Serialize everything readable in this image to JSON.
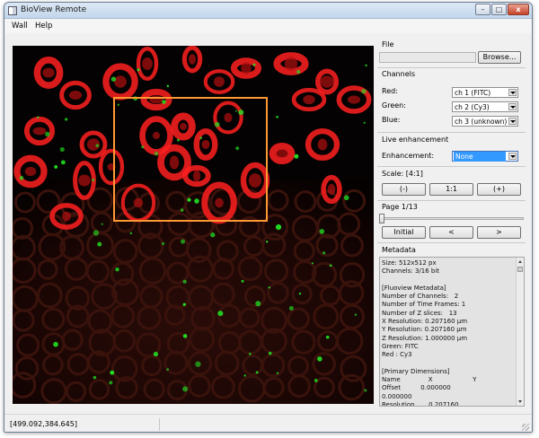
{
  "window": {
    "title": "BioView Remote",
    "minimize": "–",
    "maximize": "□",
    "close": "x"
  },
  "menu": [
    "Wall",
    "Help"
  ],
  "file": {
    "section": "File",
    "path": "",
    "browse": "Browse..."
  },
  "channels": {
    "section": "Channels",
    "red": {
      "label": "Red:",
      "value": "ch 1 (FITC)"
    },
    "green": {
      "label": "Green:",
      "value": "ch 2 (Cy3)"
    },
    "blue": {
      "label": "Blue:",
      "value": "ch 3 (unknown)"
    }
  },
  "enhancement": {
    "section": "Live enhancement",
    "label": "Enhancement:",
    "value": "None"
  },
  "scale": {
    "label": "Scale: [4:1]",
    "minus": "(-)",
    "one": "1:1",
    "plus": "(+)"
  },
  "page": {
    "label": "Page 1/13",
    "current": 1,
    "total": 13,
    "initial": "Initial",
    "prev": "<",
    "next": ">"
  },
  "metadata": {
    "section": "Metadata",
    "lines": [
      "Size: 512x512 px",
      "Channels: 3/16 bit",
      "",
      "[Fluoview Metadata]",
      "Number of Channels:   2",
      "Number of Time Frames: 1",
      "Number of Z slices:   13",
      "X Resolution: 0.207160 µm",
      "Y Resolution: 0.207160 µm",
      "Z Resolution: 1.000000 µm",
      "Green: FITC",
      "Red : Cy3",
      "",
      "[Primary Dimensions]",
      "Name              X                    Y",
      "Offset          0.000000",
      "0.000000",
      "Resolution       0.207160"
    ]
  },
  "status": {
    "coords": "[499.092,384.645]"
  },
  "colors": {
    "selection": "#ff9933",
    "red_channel": "#ff2020",
    "green_channel": "#22e022",
    "highlight": "#3399ff"
  }
}
